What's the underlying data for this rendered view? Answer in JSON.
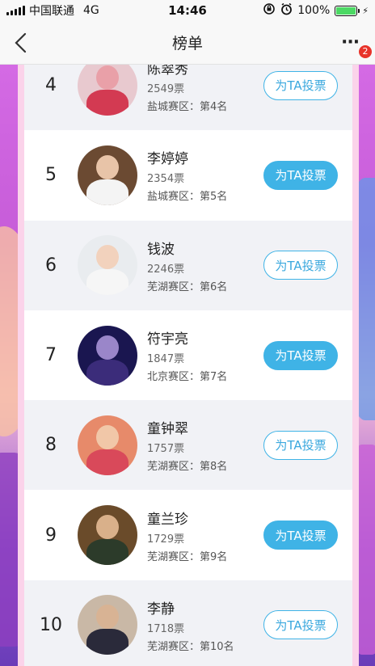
{
  "status_bar": {
    "carrier": "中国联通",
    "network": "4G",
    "time": "14:46",
    "battery": "100%"
  },
  "nav": {
    "title": "榜单",
    "badge_count": "2",
    "more_icon": "more-dots-icon",
    "back_icon": "chevron-left-icon"
  },
  "colors": {
    "accent": "#3fb3e6",
    "badge": "#e8332a"
  },
  "ranking": [
    {
      "rank": "4",
      "name": "陈翠秀",
      "votes": "2549票",
      "region": "盐城赛区：第4名",
      "button": "为TA投票",
      "button_style": "outline",
      "row_style": "alt",
      "face": "#e9a0a8",
      "body": "#d33a52",
      "bg": "#e8c9cf"
    },
    {
      "rank": "5",
      "name": "李婷婷",
      "votes": "2354票",
      "region": "盐城赛区：第5名",
      "button": "为TA投票",
      "button_style": "filled",
      "row_style": "plain",
      "face": "#e8c4a8",
      "body": "#f4f4f4",
      "bg": "#6b4a32"
    },
    {
      "rank": "6",
      "name": "钱波",
      "votes": "2246票",
      "region": "芜湖赛区：第6名",
      "button": "为TA投票",
      "button_style": "outline",
      "row_style": "alt",
      "face": "#f2d2bd",
      "body": "#f6f6f6",
      "bg": "#e9ecef"
    },
    {
      "rank": "7",
      "name": "符宇亮",
      "votes": "1847票",
      "region": "北京赛区：第7名",
      "button": "为TA投票",
      "button_style": "filled",
      "row_style": "plain",
      "face": "#9a86c9",
      "body": "#3b2c7a",
      "bg": "#1a1650"
    },
    {
      "rank": "8",
      "name": "童钟翠",
      "votes": "1757票",
      "region": "芜湖赛区：第8名",
      "button": "为TA投票",
      "button_style": "outline",
      "row_style": "alt",
      "face": "#f1c7a8",
      "body": "#d9495a",
      "bg": "#e78a6a"
    },
    {
      "rank": "9",
      "name": "童兰珍",
      "votes": "1729票",
      "region": "芜湖赛区：第9名",
      "button": "为TA投票",
      "button_style": "filled",
      "row_style": "plain",
      "face": "#d9b08a",
      "body": "#2c3b2a",
      "bg": "#6a4b2a"
    },
    {
      "rank": "10",
      "name": "李静",
      "votes": "1718票",
      "region": "芜湖赛区：第10名",
      "button": "为TA投票",
      "button_style": "outline",
      "row_style": "alt",
      "face": "#d8b394",
      "body": "#2a2a3a",
      "bg": "#c9b8a6"
    }
  ]
}
